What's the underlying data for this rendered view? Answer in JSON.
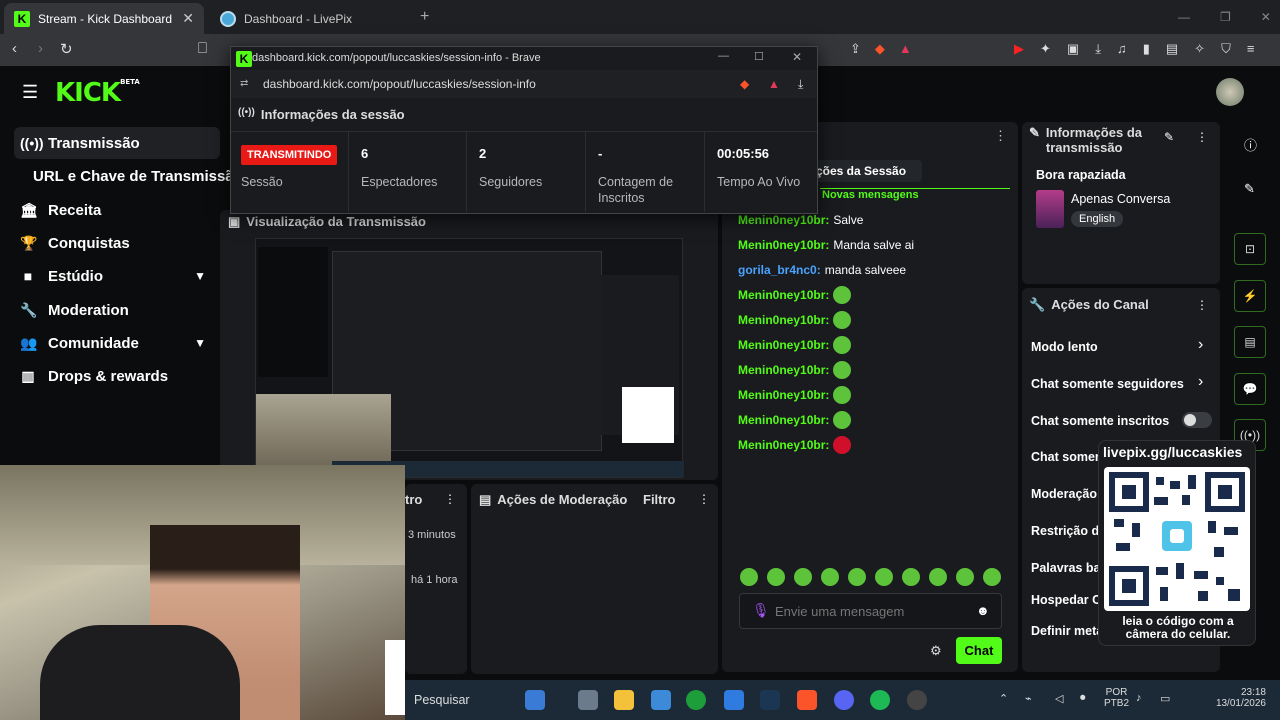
{
  "browser": {
    "tabs": [
      {
        "title": "Stream - Kick Dashboard",
        "close": "✕"
      },
      {
        "title": "Dashboard - LivePix"
      }
    ],
    "new_tab": "+"
  },
  "kick": {
    "logo": "KICK",
    "logo_badge": "BETA",
    "sidebar": [
      {
        "label": "Transmissão",
        "icon": "broadcast-icon"
      },
      {
        "label": "URL e Chave de Transmissão"
      },
      {
        "label": "Receita",
        "icon": "bank-icon"
      },
      {
        "label": "Conquistas",
        "icon": "trophy-icon"
      },
      {
        "label": "Estúdio",
        "icon": "studio-icon"
      },
      {
        "label": "Moderation",
        "icon": "wrench-icon"
      },
      {
        "label": "Comunidade",
        "icon": "people-icon"
      },
      {
        "label": "Drops & rewards",
        "icon": "drops-icon"
      }
    ],
    "preview_title": "Visualização da Transmissão",
    "session_chip": "ções da Sessão",
    "new_messages": "Novas mensagens",
    "chat": [
      {
        "user": "Menin0ney10br:",
        "msg": "Salve"
      },
      {
        "user": "Menin0ney10br:",
        "msg": "Manda salve ai"
      },
      {
        "user": "gorila_br4nc0:",
        "msg": "manda salveee",
        "user_color": "#4aa3ff"
      },
      {
        "user": "Menin0ney10br:",
        "msg": ""
      },
      {
        "user": "Menin0ney10br:",
        "msg": ""
      },
      {
        "user": "Menin0ney10br:",
        "msg": ""
      },
      {
        "user": "Menin0ney10br:",
        "msg": ""
      },
      {
        "user": "Menin0ney10br:",
        "msg": ""
      },
      {
        "user": "Menin0ney10br:",
        "msg": ""
      },
      {
        "user": "Menin0ney10br:",
        "msg": ""
      }
    ],
    "chat_input_placeholder": "Envie uma mensagem",
    "chat_button": "Chat",
    "info_panel": {
      "title": "Informações da transmissão",
      "stream_title": "Bora rapaziada",
      "category": "Apenas Conversa",
      "language": "English"
    },
    "actions_panel": {
      "title": "Ações do Canal",
      "items": [
        "Modo lento",
        "Chat somente seguidores",
        "Chat somente inscritos",
        "Chat somen",
        "Moderação",
        "Restrição de",
        "Palavras ba",
        "Hospedar C",
        "Definir meta"
      ]
    },
    "moderation_panel": {
      "title": "Ações de Moderação",
      "filter": "Filtro"
    },
    "activity_panel": {
      "filter_partial": "tro",
      "time1": "3 minutos",
      "time2": "há 1 hora"
    }
  },
  "popup": {
    "window_title": "dashboard.kick.com/popout/luccaskies/session-info - Brave",
    "url": "dashboard.kick.com/popout/luccaskies/session-info",
    "header": "Informações da sessão",
    "stats": [
      {
        "value": "TRANSMITINDO",
        "label": "Sessão"
      },
      {
        "value": "6",
        "label": "Espectadores"
      },
      {
        "value": "2",
        "label": "Seguidores"
      },
      {
        "value": "-",
        "label": "Contagem de Inscritos"
      },
      {
        "value": "00:05:56",
        "label": "Tempo Ao Vivo"
      }
    ]
  },
  "qr": {
    "url": "livepix.gg/luccaskies",
    "caption": "leia o código com a câmera do celular."
  },
  "taskbar": {
    "search": "Pesquisar",
    "lang": "POR",
    "lang2": "PTB2",
    "time": "23:18",
    "date": "13/01/2026"
  },
  "colors": {
    "accent": "#53fc18",
    "live": "#e91916",
    "bg": "#0b0c0d",
    "panel": "#191b1f"
  }
}
